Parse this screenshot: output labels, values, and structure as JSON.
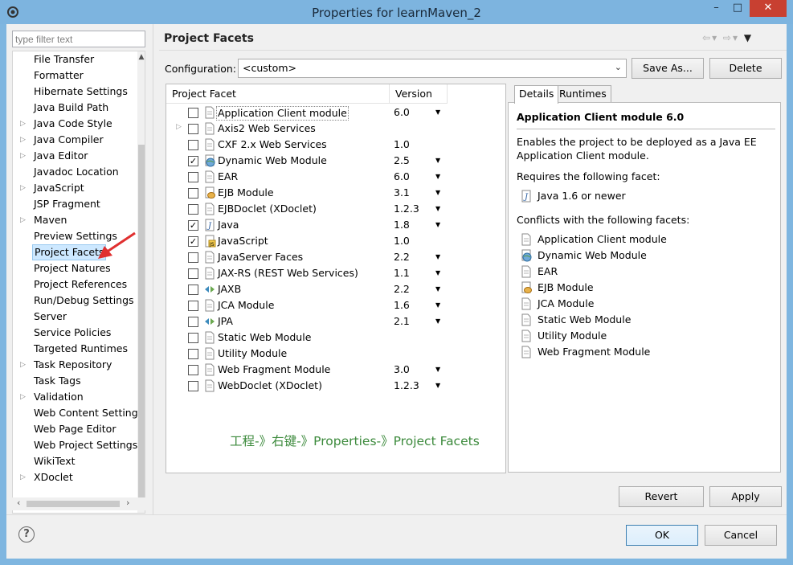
{
  "window": {
    "title": "Properties for learnMaven_2",
    "minimize": "–",
    "maximize": "□",
    "close": "✕"
  },
  "filter": {
    "placeholder": "type filter text"
  },
  "tree": {
    "items": [
      {
        "label": "File Transfer",
        "expandable": false
      },
      {
        "label": "Formatter",
        "expandable": false
      },
      {
        "label": "Hibernate Settings",
        "expandable": false
      },
      {
        "label": "Java Build Path",
        "expandable": false
      },
      {
        "label": "Java Code Style",
        "expandable": true
      },
      {
        "label": "Java Compiler",
        "expandable": true
      },
      {
        "label": "Java Editor",
        "expandable": true
      },
      {
        "label": "Javadoc Location",
        "expandable": false
      },
      {
        "label": "JavaScript",
        "expandable": true
      },
      {
        "label": "JSP Fragment",
        "expandable": false
      },
      {
        "label": "Maven",
        "expandable": true
      },
      {
        "label": "Preview Settings",
        "expandable": false
      },
      {
        "label": "Project Facets",
        "expandable": false,
        "selected": true
      },
      {
        "label": "Project Natures",
        "expandable": false
      },
      {
        "label": "Project References",
        "expandable": false
      },
      {
        "label": "Run/Debug Settings",
        "expandable": false
      },
      {
        "label": "Server",
        "expandable": false
      },
      {
        "label": "Service Policies",
        "expandable": false
      },
      {
        "label": "Targeted Runtimes",
        "expandable": false
      },
      {
        "label": "Task Repository",
        "expandable": true
      },
      {
        "label": "Task Tags",
        "expandable": false
      },
      {
        "label": "Validation",
        "expandable": true
      },
      {
        "label": "Web Content Settings",
        "expandable": false
      },
      {
        "label": "Web Page Editor",
        "expandable": false
      },
      {
        "label": "Web Project Settings",
        "expandable": false
      },
      {
        "label": "WikiText",
        "expandable": false
      },
      {
        "label": "XDoclet",
        "expandable": true
      }
    ]
  },
  "page": {
    "title": "Project Facets",
    "configuration_label": "Configuration:",
    "configuration_value": "<custom>",
    "save_as": "Save As...",
    "delete": "Delete"
  },
  "facets": {
    "col_facet": "Project Facet",
    "col_version": "Version",
    "rows": [
      {
        "name": "Application Client module",
        "version": "6.0",
        "checked": false,
        "dropdown": true,
        "icon": "page-icon",
        "selected": true
      },
      {
        "name": "Axis2 Web Services",
        "version": "",
        "checked": false,
        "dropdown": false,
        "icon": "page-icon",
        "expandable": true
      },
      {
        "name": "CXF 2.x Web Services",
        "version": "1.0",
        "checked": false,
        "dropdown": false,
        "icon": "page-icon"
      },
      {
        "name": "Dynamic Web Module",
        "version": "2.5",
        "checked": true,
        "dropdown": true,
        "icon": "globe-icon"
      },
      {
        "name": "EAR",
        "version": "6.0",
        "checked": false,
        "dropdown": true,
        "icon": "page-icon"
      },
      {
        "name": "EJB Module",
        "version": "3.1",
        "checked": false,
        "dropdown": true,
        "icon": "ejb-icon"
      },
      {
        "name": "EJBDoclet (XDoclet)",
        "version": "1.2.3",
        "checked": false,
        "dropdown": true,
        "icon": "page-icon"
      },
      {
        "name": "Java",
        "version": "1.8",
        "checked": true,
        "dropdown": true,
        "icon": "java-icon"
      },
      {
        "name": "JavaScript",
        "version": "1.0",
        "checked": true,
        "dropdown": false,
        "icon": "javascript-icon"
      },
      {
        "name": "JavaServer Faces",
        "version": "2.2",
        "checked": false,
        "dropdown": true,
        "icon": "page-icon"
      },
      {
        "name": "JAX-RS (REST Web Services)",
        "version": "1.1",
        "checked": false,
        "dropdown": true,
        "icon": "page-icon"
      },
      {
        "name": "JAXB",
        "version": "2.2",
        "checked": false,
        "dropdown": true,
        "icon": "arrows-icon"
      },
      {
        "name": "JCA Module",
        "version": "1.6",
        "checked": false,
        "dropdown": true,
        "icon": "page-icon"
      },
      {
        "name": "JPA",
        "version": "2.1",
        "checked": false,
        "dropdown": true,
        "icon": "arrows-icon"
      },
      {
        "name": "Static Web Module",
        "version": "",
        "checked": false,
        "dropdown": false,
        "icon": "page-icon"
      },
      {
        "name": "Utility Module",
        "version": "",
        "checked": false,
        "dropdown": false,
        "icon": "page-icon"
      },
      {
        "name": "Web Fragment Module",
        "version": "3.0",
        "checked": false,
        "dropdown": true,
        "icon": "page-icon"
      },
      {
        "name": "WebDoclet (XDoclet)",
        "version": "1.2.3",
        "checked": false,
        "dropdown": true,
        "icon": "page-icon"
      }
    ],
    "annotation": "工程-》右键-》Properties-》Project Facets"
  },
  "details": {
    "tab_details": "Details",
    "tab_runtimes": "Runtimes",
    "title": "Application Client module 6.0",
    "description": "Enables the project to be deployed as a Java EE Application Client module.",
    "requires_label": "Requires the following facet:",
    "requires": [
      {
        "name": "Java 1.6 or newer",
        "icon": "java-icon"
      }
    ],
    "conflicts_label": "Conflicts with the following facets:",
    "conflicts": [
      {
        "name": "Application Client module",
        "icon": "page-icon"
      },
      {
        "name": "Dynamic Web Module",
        "icon": "globe-icon"
      },
      {
        "name": "EAR",
        "icon": "page-icon"
      },
      {
        "name": "EJB Module",
        "icon": "ejb-icon"
      },
      {
        "name": "JCA Module",
        "icon": "page-icon"
      },
      {
        "name": "Static Web Module",
        "icon": "page-icon"
      },
      {
        "name": "Utility Module",
        "icon": "page-icon"
      },
      {
        "name": "Web Fragment Module",
        "icon": "page-icon"
      }
    ]
  },
  "buttons": {
    "revert": "Revert",
    "apply": "Apply",
    "ok": "OK",
    "cancel": "Cancel",
    "help": "?"
  },
  "colors": {
    "title_bar": "#7db4df",
    "close_button": "#c84031",
    "selection": "#cde8ff",
    "annotation": "#3c8a3c",
    "callout_arrow": "#e03030"
  }
}
